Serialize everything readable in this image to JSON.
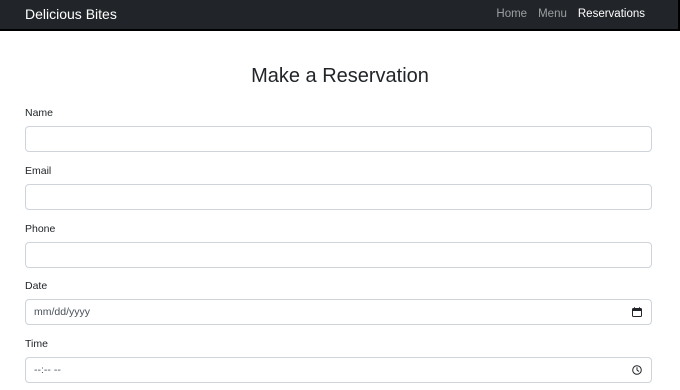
{
  "navbar": {
    "brand": "Delicious Bites",
    "links": [
      {
        "label": "Home",
        "active": false
      },
      {
        "label": "Menu",
        "active": false
      },
      {
        "label": "Reservations",
        "active": true
      }
    ]
  },
  "page": {
    "title": "Make a Reservation"
  },
  "form": {
    "name_label": "Name",
    "email_label": "Email",
    "phone_label": "Phone",
    "date_label": "Date",
    "date_placeholder": "mm/dd/yyyy",
    "time_label": "Time",
    "time_placeholder": "--:-- --"
  },
  "icons": {
    "date_picker": "calendar-icon",
    "time_picker": "clock-icon"
  }
}
